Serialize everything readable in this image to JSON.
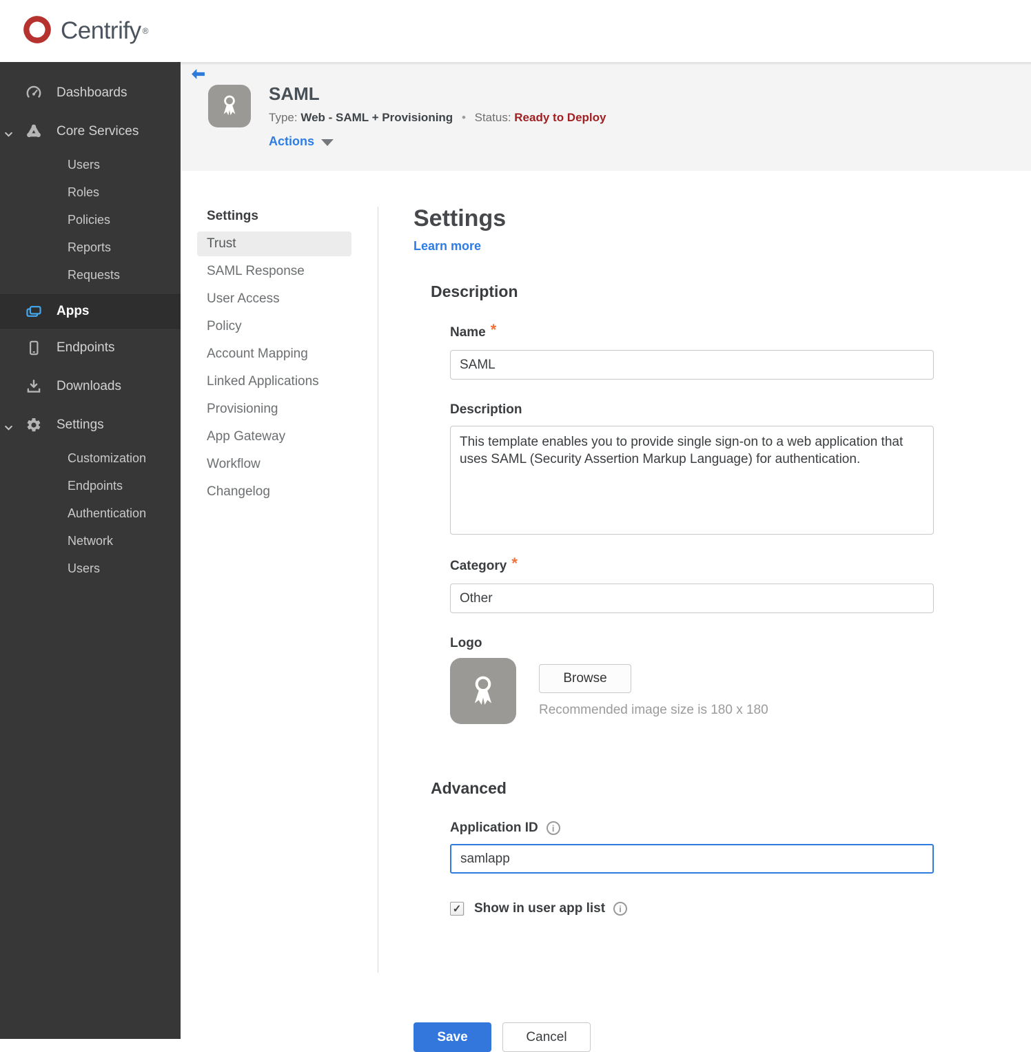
{
  "colors": {
    "accent_blue": "#2e7ce4",
    "status_red": "#a11f22",
    "save_blue": "#3377dd",
    "sidebar_bg": "#373737",
    "sidebar_active_icon": "#45aaf2",
    "asterisk_orange": "#f07137",
    "header_band": "#f4f4f4",
    "brand_red": "#b5322e"
  },
  "topbar": {
    "brand": "Centrify",
    "registered": "®"
  },
  "sidebar": {
    "dashboards": "Dashboards",
    "core_services": "Core Services",
    "core_children": [
      "Users",
      "Roles",
      "Policies",
      "Reports",
      "Requests"
    ],
    "apps": "Apps",
    "endpoints": "Endpoints",
    "downloads": "Downloads",
    "settings": "Settings",
    "settings_children": [
      "Customization",
      "Endpoints",
      "Authentication",
      "Network",
      "Users"
    ]
  },
  "app_header": {
    "title": "SAML",
    "type_label": "Type:",
    "type_value": "Web - SAML + Provisioning",
    "separator": "•",
    "status_label": "Status:",
    "status_value": "Ready to Deploy",
    "actions_label": "Actions"
  },
  "subnav": {
    "header": "Settings",
    "selected": "Trust",
    "items": [
      "Trust",
      "SAML Response",
      "User Access",
      "Policy",
      "Account Mapping",
      "Linked Applications",
      "Provisioning",
      "App Gateway",
      "Workflow",
      "Changelog"
    ]
  },
  "form": {
    "title": "Settings",
    "learn_more": "Learn more",
    "required_marker": "*",
    "sections": {
      "description": "Description",
      "advanced": "Advanced"
    },
    "name": {
      "label": "Name",
      "value": "SAML"
    },
    "description": {
      "label": "Description",
      "value": "This template enables you to provide single sign-on to a web application that uses SAML (Security Assertion Markup Language) for authentication."
    },
    "category": {
      "label": "Category",
      "value": "Other"
    },
    "logo": {
      "label": "Logo",
      "browse_label": "Browse",
      "hint": "Recommended image size is 180 x 180"
    },
    "application_id": {
      "label": "Application ID",
      "value": "samlapp"
    },
    "show_in_user_app_list": {
      "label": "Show in user app list",
      "checked": true
    },
    "save_label": "Save",
    "cancel_label": "Cancel"
  },
  "icons": {
    "info_glyph": "i",
    "check_glyph": "✓"
  }
}
